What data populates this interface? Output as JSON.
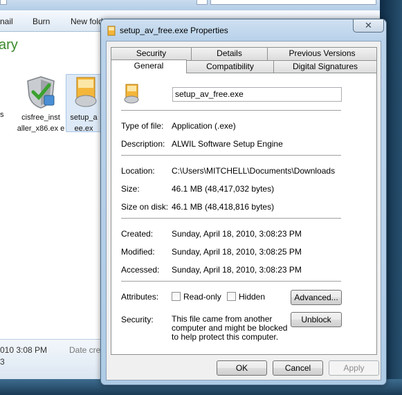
{
  "explorer": {
    "toolbar": {
      "email_fragment": "nail",
      "burn_label": "Burn",
      "newfolder_fragment": "New fold"
    },
    "library_title_fragment": "ary",
    "left_fragment": "s",
    "files": [
      {
        "name": "cisfree_installer_x86.exe",
        "name_display": "cisfree_inst aller_x86.ex e"
      },
      {
        "name": "setup_av_free.exe",
        "name_display": "setup_a ee.ex"
      }
    ],
    "details": {
      "date_fragment": "010 3:08 PM",
      "date_created_label": "Date crea",
      "bottom_fragment": "3"
    }
  },
  "dialog": {
    "title": "setup_av_free.exe Properties",
    "close_glyph": "✕",
    "tabs": {
      "row1": [
        "Security",
        "Details",
        "Previous Versions"
      ],
      "row2": [
        "General",
        "Compatibility",
        "Digital Signatures"
      ],
      "active": "General"
    },
    "general": {
      "file_name": "setup_av_free.exe",
      "type_label": "Type of file:",
      "type_value": "Application (.exe)",
      "description_label": "Description:",
      "description_value": "ALWIL Software Setup Engine",
      "location_label": "Location:",
      "location_value": "C:\\Users\\MITCHELL\\Documents\\Downloads",
      "size_label": "Size:",
      "size_value": "46.1 MB (48,417,032 bytes)",
      "size_on_disk_label": "Size on disk:",
      "size_on_disk_value": "46.1 MB (48,418,816 bytes)",
      "created_label": "Created:",
      "created_value": "Sunday, April 18, 2010, 3:08:23 PM",
      "modified_label": "Modified:",
      "modified_value": "Sunday, April 18, 2010, 3:08:25 PM",
      "accessed_label": "Accessed:",
      "accessed_value": "Sunday, April 18, 2010, 3:08:23 PM",
      "attributes_label": "Attributes:",
      "readonly_label": "Read-only",
      "readonly_checked": false,
      "hidden_label": "Hidden",
      "hidden_checked": false,
      "advanced_button": "Advanced...",
      "security_label": "Security:",
      "security_text": "This file came from another computer and might be blocked to help protect this computer.",
      "unblock_button": "Unblock"
    },
    "buttons": {
      "ok": "OK",
      "cancel": "Cancel",
      "apply": "Apply"
    }
  },
  "colors": {
    "library_title": "#3a8a2a",
    "dialog_frame": "#b9d2ea",
    "button_border": "#707070"
  }
}
